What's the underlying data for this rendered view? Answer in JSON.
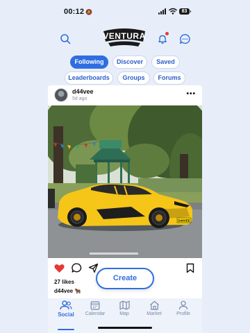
{
  "status_bar": {
    "time": "00:12",
    "battery": "83"
  },
  "header": {
    "logo_text": "VENTURA"
  },
  "filters": [
    {
      "label": "Following",
      "active": true
    },
    {
      "label": "Discover",
      "active": false
    },
    {
      "label": "Saved",
      "active": false
    },
    {
      "label": "Leaderboards",
      "active": false
    },
    {
      "label": "Groups",
      "active": false
    },
    {
      "label": "Forums",
      "active": false
    }
  ],
  "post": {
    "username": "d44vee",
    "time_ago": "5d ago",
    "plate": "D44VEE",
    "likes": "27 likes",
    "caption_user": "d44vee",
    "caption_emoji": "🐂"
  },
  "create_button": {
    "label": "Create"
  },
  "nav": [
    {
      "label": "Social",
      "active": true
    },
    {
      "label": "Calendar",
      "active": false
    },
    {
      "label": "Map",
      "active": false
    },
    {
      "label": "Market",
      "active": false
    },
    {
      "label": "Profile",
      "active": false
    }
  ],
  "colors": {
    "accent": "#2f6ee0",
    "like": "#e53935",
    "car": "#f5c518"
  }
}
